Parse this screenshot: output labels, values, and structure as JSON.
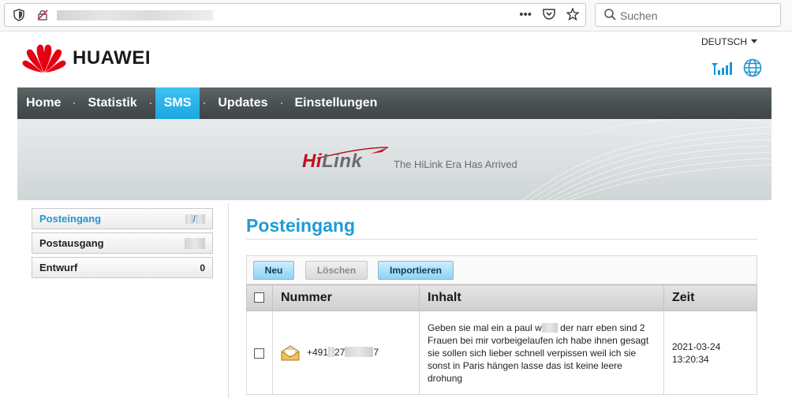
{
  "browser": {
    "search_placeholder": "Suchen",
    "icons": [
      "shield-icon",
      "tracking-blocked-icon",
      "more-actions-icon",
      "pocket-icon",
      "bookmark-star-icon",
      "search-icon"
    ]
  },
  "header": {
    "brand": "HUAWEI",
    "language": "DEUTSCH",
    "icons": [
      "signal-strength-icon",
      "globe-icon"
    ]
  },
  "nav": {
    "items": [
      "Home",
      "Statistik",
      "SMS",
      "Updates",
      "Einstellungen"
    ],
    "selected": "SMS"
  },
  "banner": {
    "logo_hi": "Hi",
    "logo_link": "Link",
    "tagline": "The HiLink Era Has Arrived"
  },
  "sidebar": {
    "items": [
      {
        "label": "Posteingang",
        "count": "/"
      },
      {
        "label": "Postausgang",
        "count": ""
      },
      {
        "label": "Entwurf",
        "count": "0"
      }
    ],
    "selected": "Posteingang"
  },
  "main": {
    "title": "Posteingang",
    "buttons": {
      "new": "Neu",
      "delete": "Löschen",
      "import": "Importieren"
    },
    "columns": [
      "Nummer",
      "Inhalt",
      "Zeit"
    ],
    "rows": [
      {
        "number_a": "+491",
        "number_b": "27",
        "number_c": "7",
        "content_a": "Geben sie mal ein a paul w",
        "content_b": "der narr eben sind 2 Frauen bei mir vorbeigelaufen ich habe ihnen gesagt sie sollen sich lieber schnell verpissen weil ich sie sonst in Paris hängen lasse das ist keine leere drohung",
        "date": "2021-03-24",
        "time": "13:20:34"
      }
    ]
  },
  "colors": {
    "accent": "#1f9bd3",
    "nav_selected": "#1aa7e1",
    "brand_red": "#c1121f"
  }
}
